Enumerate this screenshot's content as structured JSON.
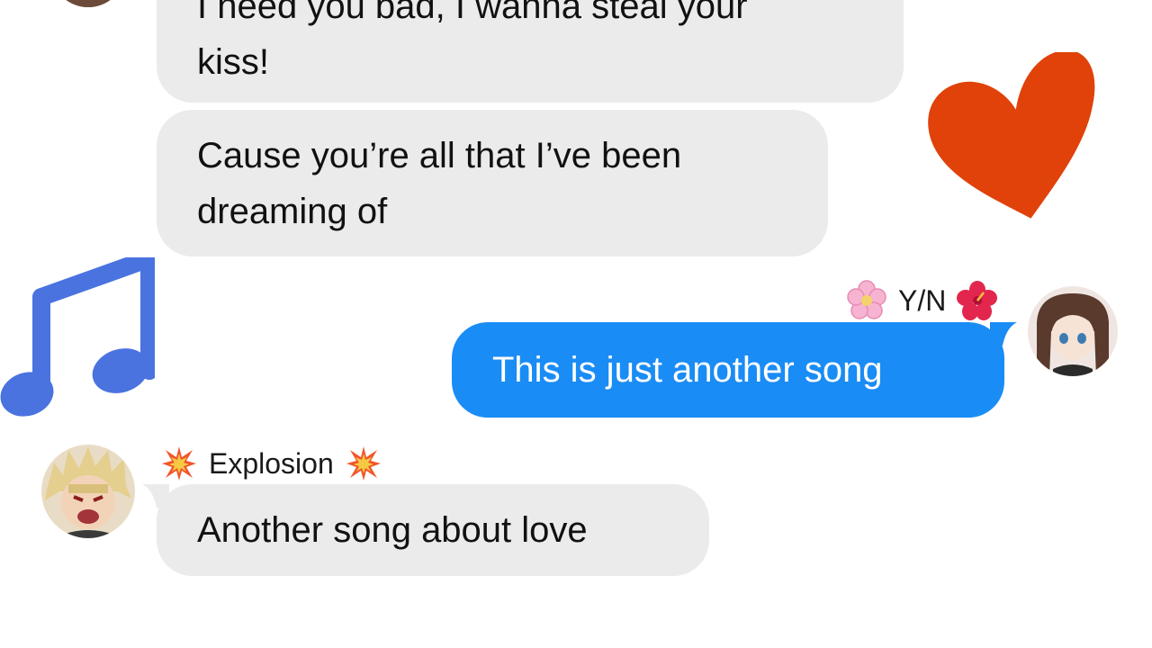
{
  "thread": {
    "messages": [
      {
        "sender": "other",
        "lines": [
          "I need you bad, I wanna steal your",
          "kiss!"
        ]
      },
      {
        "sender": "other",
        "lines": [
          "Cause you’re all that I’ve been",
          "dreaming of"
        ]
      },
      {
        "sender": "self",
        "name": "Y/N",
        "name_left_icon": "cherry-blossom-icon",
        "name_right_icon": "hibiscus-icon",
        "lines": [
          "This is just another song"
        ]
      },
      {
        "sender": "other",
        "name": "Explosion",
        "name_left_icon": "collision-icon",
        "name_right_icon": "collision-icon",
        "lines": [
          "Another song about love"
        ]
      }
    ]
  },
  "overlays": {
    "heart_icon": "heart-icon",
    "music_note_icon": "music-note-icon"
  },
  "colors": {
    "incoming_bubble": "#ebebeb",
    "outgoing_bubble": "#1a8cf5",
    "heart": "#e0420a",
    "music_note": "#4a73e0"
  }
}
